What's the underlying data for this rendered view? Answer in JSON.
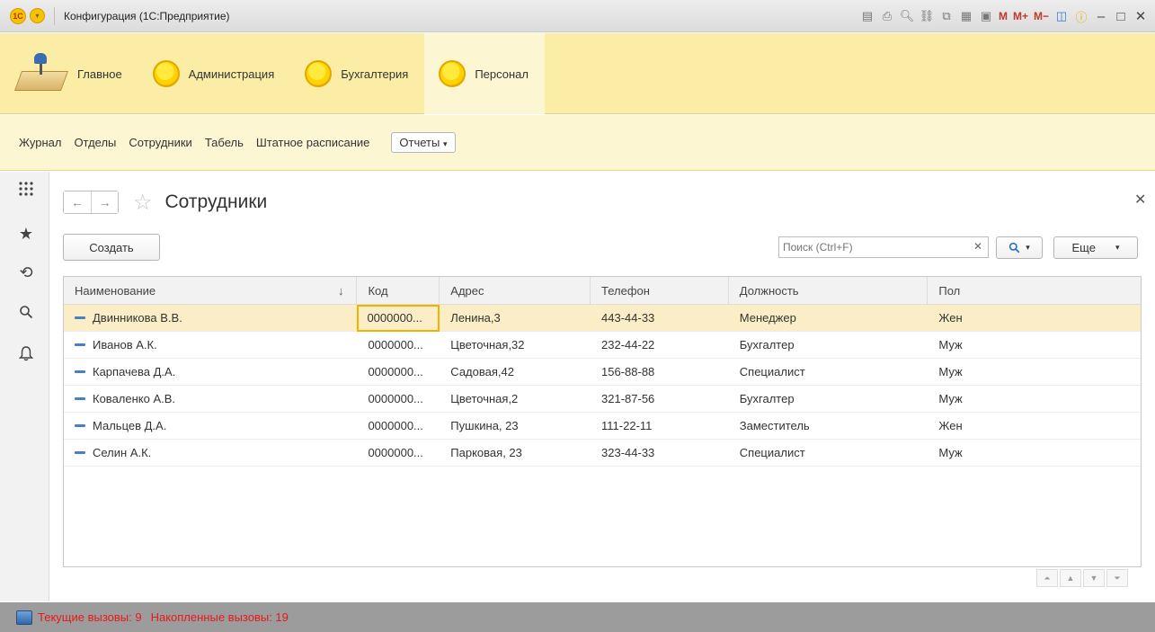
{
  "window": {
    "title": "Конфигурация (1С:Предприятие)",
    "logo": "1С"
  },
  "sections": [
    {
      "label": "Главное",
      "icon": "home-desk-icon"
    },
    {
      "label": "Администрация",
      "icon": "sun-icon"
    },
    {
      "label": "Бухгалтерия",
      "icon": "sun-icon"
    },
    {
      "label": "Персонал",
      "icon": "sun-icon"
    }
  ],
  "functions": {
    "items": [
      "Журнал",
      "Отделы",
      "Сотрудники",
      "Табель",
      "Штатное расписание"
    ],
    "reports_label": "Отчеты"
  },
  "titlebar_letters": {
    "m": "M",
    "mplus": "M+",
    "mminus": "M−"
  },
  "form": {
    "title": "Сотрудники",
    "create_label": "Создать",
    "search_placeholder": "Поиск (Ctrl+F)",
    "more_label": "Еще"
  },
  "table": {
    "columns": [
      "Наименование",
      "Код",
      "Адрес",
      "Телефон",
      "Должность",
      "Пол"
    ],
    "rows": [
      {
        "name": "Двинникова В.В.",
        "code": "0000000...",
        "address": "Ленина,3",
        "phone": "443-44-33",
        "position": "Менеджер",
        "sex": "Жен"
      },
      {
        "name": "Иванов А.К.",
        "code": "0000000...",
        "address": "Цветочная,32",
        "phone": "232-44-22",
        "position": "Бухгалтер",
        "sex": "Муж"
      },
      {
        "name": "Карпачева Д.А.",
        "code": "0000000...",
        "address": "Садовая,42",
        "phone": "156-88-88",
        "position": "Специалист",
        "sex": "Муж"
      },
      {
        "name": "Коваленко А.В.",
        "code": "0000000...",
        "address": "Цветочная,2",
        "phone": "321-87-56",
        "position": "Бухгалтер",
        "sex": "Муж"
      },
      {
        "name": "Мальцев Д.А.",
        "code": "0000000...",
        "address": "Пушкина, 23",
        "phone": "111-22-11",
        "position": "Заместитель",
        "sex": "Жен"
      },
      {
        "name": "Селин А.К.",
        "code": "0000000...",
        "address": "Парковая, 23",
        "phone": "323-44-33",
        "position": "Специалист",
        "sex": "Муж"
      }
    ]
  },
  "status": {
    "current_calls": "Текущие вызовы: 9",
    "accumulated_calls": "Накопленные вызовы: 19",
    "text_color": "#e8191b"
  },
  "colors": {
    "sections_bg": "#fbeda6",
    "functions_bg": "#fdf6d2",
    "selected_row": "#fbeec6",
    "focus_border": "#f0b400"
  }
}
